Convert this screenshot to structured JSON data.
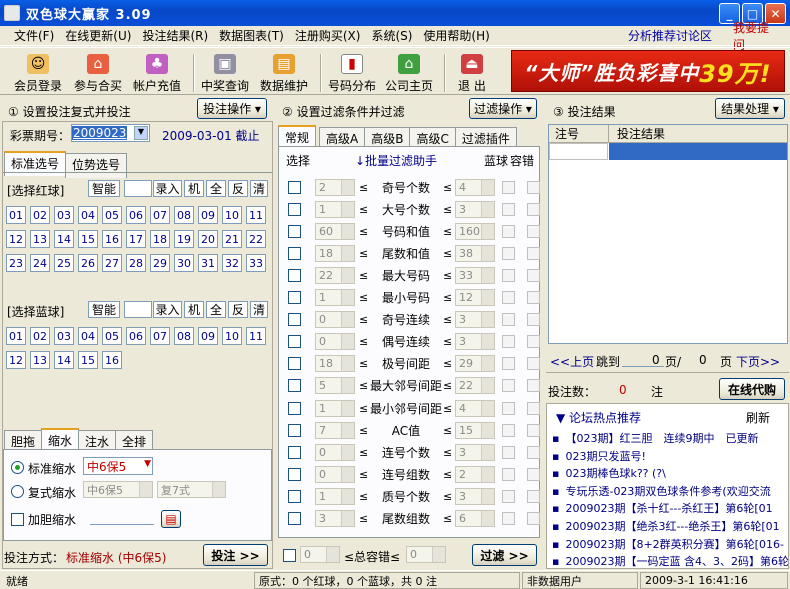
{
  "window": {
    "title": "双色球大赢家 3.09"
  },
  "menu": {
    "items": [
      "文件(F)",
      "在线更新(U)",
      "投注结果(R)",
      "数据图表(T)",
      "注册购买(X)",
      "系统(S)",
      "使用帮助(H)"
    ],
    "link_forum": "分析推荐讨论区",
    "link_help": "我要提问"
  },
  "toolbar": {
    "buttons": [
      "会员登录",
      "参与合买",
      "帐户充值",
      "中奖查询",
      "数据维护",
      "号码分布",
      "公司主页",
      "退 出"
    ]
  },
  "banner": {
    "text_pre": "“大师”胜负彩喜中",
    "text_amount": "39万!"
  },
  "panel1": {
    "heading": "① 设置投注复式并投注",
    "action_btn": "投注操作 ▾",
    "period_label": "彩票期号：",
    "period_value": "2009023",
    "date_text": "2009-03-01 截止",
    "tabs": [
      "标准选号",
      "位势选号"
    ],
    "red": {
      "label": "[选择红球]",
      "buttons": [
        "智能",
        "录入",
        "机",
        "全",
        "反",
        "清"
      ],
      "numbers": [
        "01",
        "02",
        "03",
        "04",
        "05",
        "06",
        "07",
        "08",
        "09",
        "10",
        "11",
        "12",
        "13",
        "14",
        "15",
        "16",
        "17",
        "18",
        "19",
        "20",
        "21",
        "22",
        "23",
        "24",
        "25",
        "26",
        "27",
        "28",
        "29",
        "30",
        "31",
        "32",
        "33"
      ]
    },
    "blue": {
      "label": "[选择蓝球]",
      "buttons": [
        "智能",
        "录入",
        "机",
        "全",
        "反",
        "清"
      ],
      "numbers": [
        "01",
        "02",
        "03",
        "04",
        "05",
        "06",
        "07",
        "08",
        "09",
        "10",
        "11",
        "12",
        "13",
        "14",
        "15",
        "16"
      ]
    },
    "subtabs": [
      "胆拖",
      "缩水",
      "注水",
      "全排"
    ],
    "std_label": "标准缩水",
    "std_value": "中6保5",
    "dup_label": "复式缩水",
    "dup_value": "中6保5",
    "dup_value2": "复7式",
    "dan_label": "加胆缩水",
    "mode_label": "投注方式：",
    "mode_value": "标准缩水 (中6保5)",
    "bet_btn": "投注 >>"
  },
  "panel2": {
    "heading": "② 设置过滤条件并过滤",
    "action_btn": "过滤操作 ▾",
    "tabs": [
      "常规",
      "高级A",
      "高级B",
      "高级C",
      "过滤插件"
    ],
    "col_select": "选择",
    "col_helper": "↓批量过滤助手",
    "col_blue": "蓝球",
    "col_tol": "容错",
    "rows": [
      {
        "min": "2",
        "name": "奇号个数",
        "max": "4"
      },
      {
        "min": "1",
        "name": "大号个数",
        "max": "3"
      },
      {
        "min": "60",
        "name": "号码和值",
        "max": "160"
      },
      {
        "min": "18",
        "name": "尾数和值",
        "max": "38"
      },
      {
        "min": "22",
        "name": "最大号码",
        "max": "33"
      },
      {
        "min": "1",
        "name": "最小号码",
        "max": "12"
      },
      {
        "min": "0",
        "name": "奇号连续",
        "max": "3"
      },
      {
        "min": "0",
        "name": "偶号连续",
        "max": "3"
      },
      {
        "min": "18",
        "name": "极号间距",
        "max": "29"
      },
      {
        "min": "5",
        "name": "最大邻号间距",
        "max": "22"
      },
      {
        "min": "1",
        "name": "最小邻号间距",
        "max": "4"
      },
      {
        "min": "7",
        "name": "AC值",
        "max": "15"
      },
      {
        "min": "0",
        "name": "连号个数",
        "max": "3"
      },
      {
        "min": "0",
        "name": "连号组数",
        "max": "2"
      },
      {
        "min": "1",
        "name": "质号个数",
        "max": "3"
      },
      {
        "min": "3",
        "name": "尾数组数",
        "max": "6"
      }
    ],
    "sym": "≤",
    "total_min": "0",
    "total_label": "≤总容错≤",
    "total_max": "0",
    "filter_btn": "过滤 >>"
  },
  "panel3": {
    "heading": "③ 投注结果",
    "action_btn": "结果处理 ▾",
    "col_no": "注号",
    "col_result": "投注结果",
    "prev": "<<上页",
    "jump": "跳到",
    "page_cur": "0",
    "page_unit": "页/",
    "page_total": "0",
    "page_unit2": "页",
    "next": "下页>>",
    "count_label": "投注数：",
    "count_value": "0",
    "count_unit": "注",
    "online_btn": "在线代购",
    "forum_title": "▼  论坛热点推荐",
    "refresh": "刷新",
    "forum_items": [
      "【023期】红三胆　连续9期中　已更新",
      "023期只发蓝号!",
      "023期棒色球k?? (?\\",
      "专玩乐透-023期双色球条件参考(欢迎交流",
      "2009023期【杀十红---杀红王】第6轮[01",
      "2009023期【绝杀3红---绝杀王】第6轮[01",
      "2009023期【8+2群英积分赛】第6轮[016-",
      "2009023期【一码定蓝 含4、3、2码】第6轮"
    ]
  },
  "statusbar": {
    "ready": "就绪",
    "orig": "原式：0 个红球，0 个蓝球，共 0 注",
    "user": "非数据用户",
    "datetime": "2009-3-1  16:41:16"
  }
}
